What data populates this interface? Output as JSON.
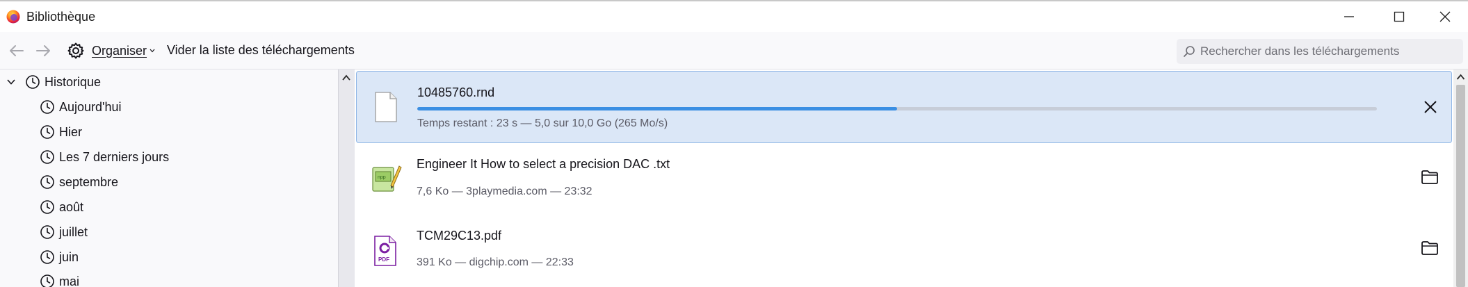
{
  "window": {
    "title": "Bibliothèque",
    "controls": {
      "minimize": "minimize-icon",
      "maximize": "maximize-icon",
      "close": "close-icon"
    }
  },
  "toolbar": {
    "organize_label": "Organiser",
    "clear_label": "Vider la liste des téléchargements",
    "search_placeholder": "Rechercher dans les téléchargements"
  },
  "sidebar": {
    "root": {
      "label": "Historique",
      "expanded": true
    },
    "items": [
      {
        "label": "Aujourd'hui"
      },
      {
        "label": "Hier"
      },
      {
        "label": "Les 7 derniers jours"
      },
      {
        "label": "septembre"
      },
      {
        "label": "août"
      },
      {
        "label": "juillet"
      },
      {
        "label": "juin"
      },
      {
        "label": "mai"
      }
    ]
  },
  "downloads": [
    {
      "name": "10485760.rnd",
      "status": "Temps restant : 23 s — 5,0 sur 10,0 Go (265 Mo/s)",
      "progress_fraction": 0.5,
      "state": "in-progress",
      "icon": "generic-file-icon",
      "action": "cancel-icon"
    },
    {
      "name": "Engineer It How to select a precision DAC .txt",
      "status": "7,6 Ko — 3playmedia.com — 23:32",
      "state": "done",
      "icon": "notepad-file-icon",
      "action": "folder-icon"
    },
    {
      "name": "TCM29C13.pdf",
      "status": "391 Ko — digchip.com — 22:33",
      "state": "done",
      "icon": "pdf-file-icon",
      "action": "folder-icon"
    }
  ],
  "colors": {
    "accent": "#3b8fe3",
    "selection": "#dbe7f7",
    "pdf": "#7b1fa2"
  }
}
